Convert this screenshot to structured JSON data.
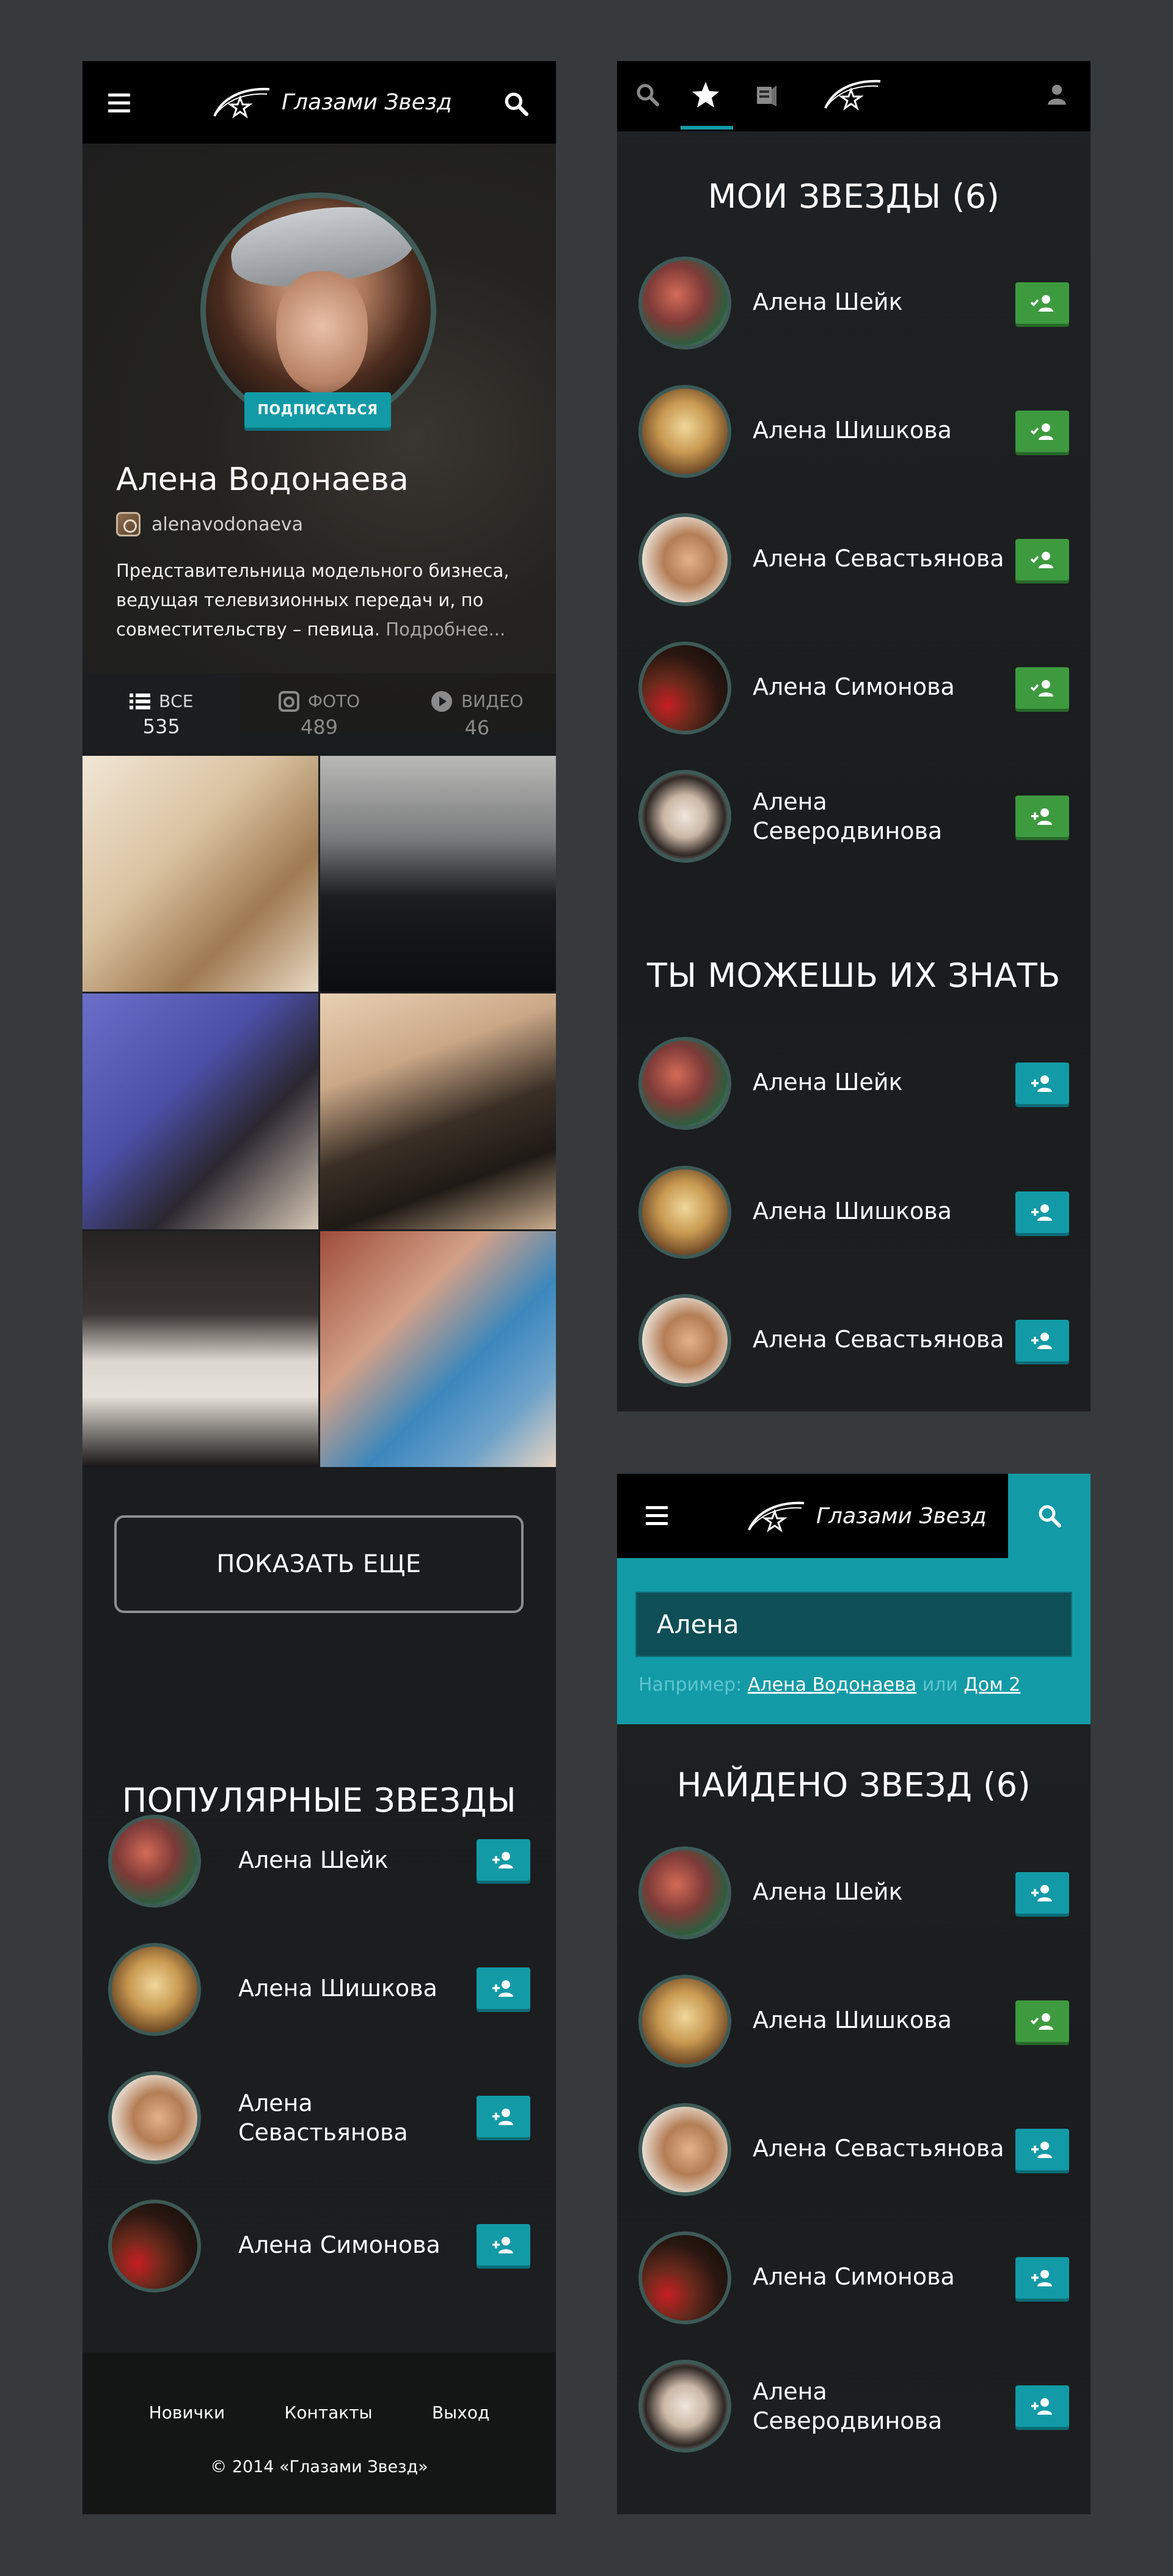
{
  "brand": {
    "name": "Глазами Звезд"
  },
  "colors": {
    "accent": "#139aa7",
    "added": "#3e9a3e",
    "background": "#363a3d",
    "panel": "#1c1e20"
  },
  "profile": {
    "subscribe_label": "ПОДПИСАТЬСЯ",
    "name": "Алена Водонаева",
    "instagram_handle": "alenavodonaeva",
    "bio": "Представительница модельного бизнеса, ведущая телевизионных передач и, по совместительству – певица.",
    "more_label": "Подробнее..."
  },
  "tabs": [
    {
      "label": "ВСЕ",
      "count": "535",
      "icon": "list-icon"
    },
    {
      "label": "ФОТО",
      "count": "489",
      "icon": "camera-icon"
    },
    {
      "label": "ВИДЕО",
      "count": "46",
      "icon": "play-icon"
    }
  ],
  "show_more_label": "ПОКАЗАТЬ ЕЩЕ",
  "popular": {
    "title": "ПОПУЛЯРНЫЕ ЗВЕЗДЫ",
    "items": [
      {
        "name": "Алена Шейк",
        "state": "add"
      },
      {
        "name": "Алена Шишкова",
        "state": "add"
      },
      {
        "name_line1": "Алена",
        "name_line2": "Севастьянова",
        "state": "add"
      },
      {
        "name": "Алена Симонова",
        "state": "add"
      }
    ]
  },
  "footer": {
    "links": [
      "Новички",
      "Контакты",
      "Выход"
    ],
    "copyright": "© 2014 «Глазами Звезд»"
  },
  "my_stars": {
    "title": "МОИ ЗВЕЗДЫ (6)",
    "items": [
      {
        "name": "Алена Шейк",
        "state": "added"
      },
      {
        "name": "Алена Шишкова",
        "state": "added"
      },
      {
        "name": "Алена Севастьянова",
        "state": "added"
      },
      {
        "name": "Алена Симонова",
        "state": "added"
      },
      {
        "name_line1": "Алена",
        "name_line2": "Северодвинова",
        "state": "add-green"
      }
    ]
  },
  "may_know": {
    "title": "ТЫ МОЖЕШЬ ИХ ЗНАТЬ",
    "items": [
      {
        "name": "Алена Шейк",
        "state": "add"
      },
      {
        "name": "Алена Шишкова",
        "state": "add"
      },
      {
        "name": "Алена Севастьянова",
        "state": "add"
      }
    ]
  },
  "search": {
    "query": "Алена",
    "hint_prefix": "Например:",
    "hint_example1": "Алена Водонаева",
    "hint_or": "или",
    "hint_example2": "Дом 2"
  },
  "found": {
    "title": "НАЙДЕНО ЗВЕЗД (6)",
    "items": [
      {
        "name": "Алена Шейк",
        "state": "add"
      },
      {
        "name": "Алена Шишкова",
        "state": "added"
      },
      {
        "name": "Алена Севастьянова",
        "state": "add"
      },
      {
        "name": "Алена Симонова",
        "state": "add"
      },
      {
        "name_line1": "Алена",
        "name_line2": "Северодвинова",
        "state": "add"
      }
    ]
  }
}
